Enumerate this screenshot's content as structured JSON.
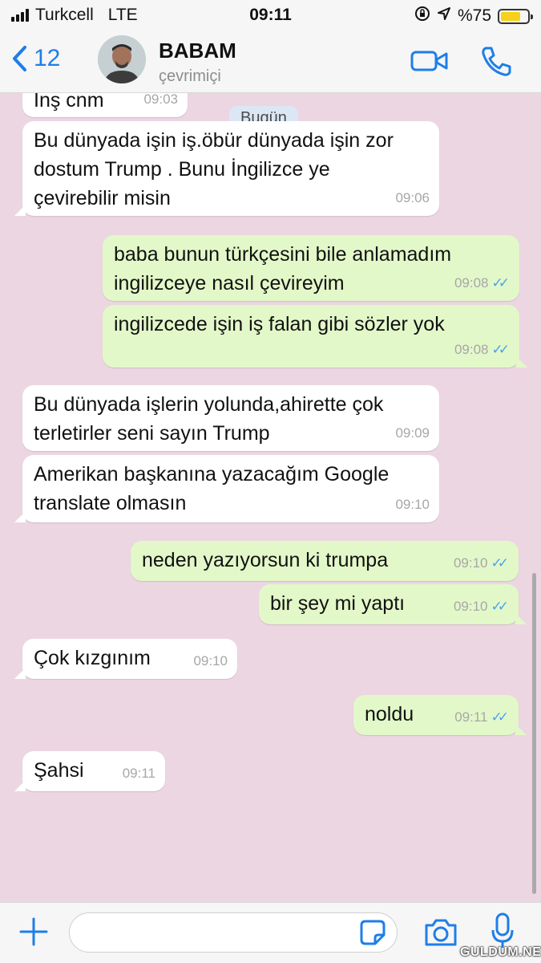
{
  "status_bar": {
    "carrier": "Turkcell",
    "network": "LTE",
    "time": "09:11",
    "battery": "%75",
    "battery_level": 0.75
  },
  "header": {
    "back_count": "12",
    "contact_name": "BABAM",
    "contact_status": "çevrimiçi"
  },
  "date_pill": "Bugün",
  "messages": [
    {
      "dir": "in",
      "text": "Inş cnm",
      "time": "09:03"
    },
    {
      "dir": "in",
      "text": "Bu dünyada işin iş.öbür dünyada işin zor\ndostum Trump . Bunu İngilizce ye\nçevirebilir misin",
      "time": "09:06"
    },
    {
      "dir": "out",
      "text": "baba bunun türkçesini bile anlamadım\ningilizceye nasıl çevireyim",
      "time": "09:08"
    },
    {
      "dir": "out",
      "text": "ingilizcede işin iş falan gibi sözler yok",
      "time": "09:08"
    },
    {
      "dir": "in",
      "text": "Bu dünyada işlerin yolunda,ahirette çok\nterletirler seni sayın Trump",
      "time": "09:09"
    },
    {
      "dir": "in",
      "text": "Amerikan başkanına yazacağım Google\ntranslate olmasın",
      "time": "09:10"
    },
    {
      "dir": "out",
      "text": "neden yazıyorsun ki trumpa",
      "time": "09:10"
    },
    {
      "dir": "out",
      "text": "bir şey mi yaptı",
      "time": "09:10"
    },
    {
      "dir": "in",
      "text": "Çok kızgınım",
      "time": "09:10"
    },
    {
      "dir": "out",
      "text": "noldu",
      "time": "09:11"
    },
    {
      "dir": "in",
      "text": "Şahsi",
      "time": "09:11"
    }
  ],
  "input": {
    "placeholder": ""
  },
  "watermark": "GULDUM.NET",
  "colors": {
    "accent": "#1e7ee8",
    "incoming": "#ffffff",
    "outgoing": "#e3f8c9",
    "background": "#ecd6e2",
    "read_tick": "#4aa3ec"
  }
}
